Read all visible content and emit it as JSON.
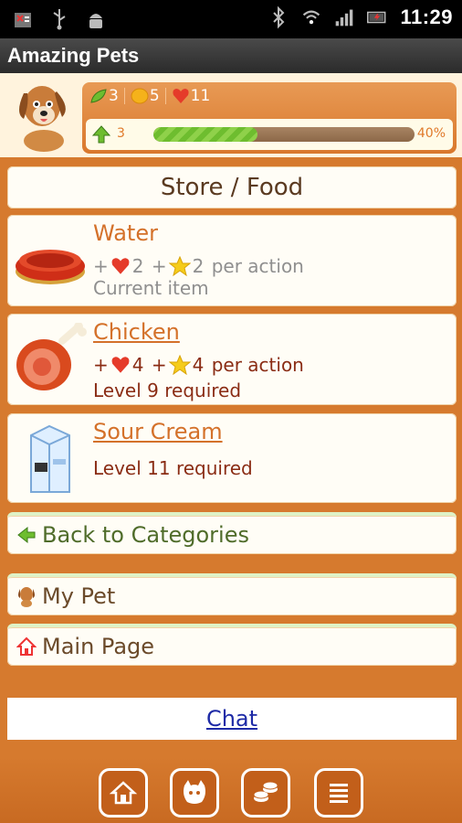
{
  "statusbar": {
    "time": "11:29"
  },
  "app": {
    "title": "Amazing Pets"
  },
  "stats": {
    "food": "3",
    "coins": "5",
    "hearts": "11"
  },
  "xp": {
    "level": "3",
    "percent_label": "40%",
    "progress": 0.4
  },
  "section": {
    "title": "Store / Food"
  },
  "items": [
    {
      "name": "Water",
      "line1_prefix": "+",
      "line1_hearts": "2",
      "line1_mid": " +",
      "line1_stars": "2",
      "line1_suffix": " per action",
      "line2": "Current item"
    },
    {
      "name": "Chicken",
      "line1_prefix": "+",
      "line1_hearts": "4",
      "line1_mid": " +",
      "line1_stars": "4",
      "line1_suffix": " per action",
      "line2": "Level 9 required"
    },
    {
      "name": "Sour Cream",
      "line2": "Level 11 required"
    }
  ],
  "nav": {
    "back_label": "Back to Categories",
    "my_pet_label": "My Pet",
    "main_page_label": "Main Page",
    "chat_label": "Chat"
  },
  "colors": {
    "orange": "#d67a2e",
    "link_orange": "#d4712a",
    "dark_red": "#8a2c14",
    "green": "#6ebd2f"
  },
  "icons": {
    "tabs": [
      "home-icon",
      "cat-icon",
      "coins-icon",
      "list-icon"
    ]
  }
}
